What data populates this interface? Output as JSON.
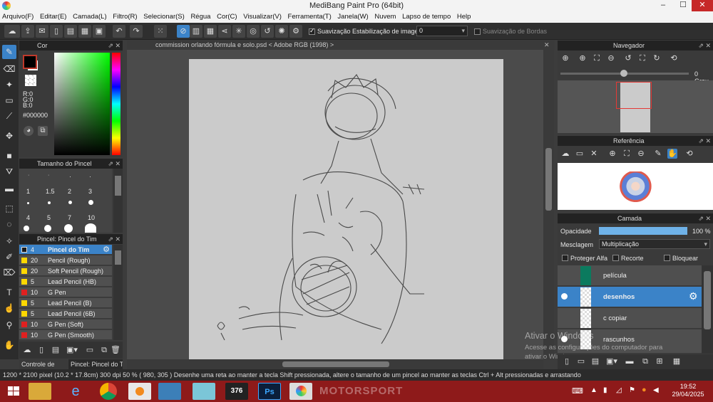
{
  "window": {
    "title": "MediBang Paint Pro (64bit)",
    "minimize": "–",
    "maximize": "☐",
    "close": "✕"
  },
  "menu": [
    "Arquivo(F)",
    "Editar(E)",
    "Camada(L)",
    "Filtro(R)",
    "Selecionar(S)",
    "Régua",
    "Cor(C)",
    "Visualizar(V)",
    "Ferramenta(T)",
    "Janela(W)",
    "Nuvem",
    "Lapso de tempo",
    "Help"
  ],
  "toolbar": {
    "smoothing_label": "Suavização",
    "stabilization_label": "Estabilização de imagens",
    "stabilization_value": "0",
    "edge_smoothing_label": "Suavização de Bordas"
  },
  "color_panel": {
    "title": "Cor",
    "r": "R:0",
    "g": "G:0",
    "b": "B:0",
    "hex": "#000000",
    "fg": "#000000",
    "bg": "#ffffff"
  },
  "brush_size_panel": {
    "title": "Tamanho do Pincel",
    "row1": [
      "1",
      "1.5",
      "2",
      "3"
    ],
    "row2": [
      "4",
      "5",
      "7",
      "10"
    ]
  },
  "brush_panel": {
    "title": "Pincel: Pincel do Tim",
    "items": [
      {
        "size": "4",
        "name": "Pincel do Tim",
        "color": "#1a1a1a"
      },
      {
        "size": "20",
        "name": "Pencil (Rough)",
        "color": "#ffd800"
      },
      {
        "size": "20",
        "name": "Soft Pencil (Rough)",
        "color": "#ffd800"
      },
      {
        "size": "5",
        "name": "Lead Pencil (HB)",
        "color": "#ffd800"
      },
      {
        "size": "10",
        "name": "G Pen",
        "color": "#e02020"
      },
      {
        "size": "5",
        "name": "Lead Pencil (B)",
        "color": "#ffd800"
      },
      {
        "size": "5",
        "name": "Lead Pencil (6B)",
        "color": "#ffd800"
      },
      {
        "size": "10",
        "name": "G Pen (Soft)",
        "color": "#e02020"
      },
      {
        "size": "10",
        "name": "G Pen (Smooth)",
        "color": "#e02020"
      }
    ]
  },
  "bottom_tabs": {
    "left": "Controle de Pincel",
    "right": "Pincel: Pincel do Tim"
  },
  "document": {
    "tab": "commission orlando fórmula e solo.psd < Adobe RGB (1998) >"
  },
  "navigator": {
    "title": "Navegador",
    "angle": "0 Grau"
  },
  "reference": {
    "title": "Referência"
  },
  "layer_panel": {
    "title": "Camada",
    "opacity_label": "Opacidade",
    "opacity_value": "100 %",
    "opacity_fraction": 1.0,
    "blend_label": "Mesclagem",
    "blend_value": "Multiplicação",
    "protect_alpha": "Proteger Alfa",
    "clipping": "Recorte",
    "lock": "Bloquear",
    "layers": [
      {
        "name": "película",
        "color": "#0b7a5e"
      },
      {
        "name": "desenhos"
      },
      {
        "name": "c copiar"
      },
      {
        "name": "rascunhos"
      }
    ]
  },
  "watermark": {
    "line1": "Ativar o Windows",
    "line2": "Acesse as configurações do computador para",
    "line3": "ativar o Windows."
  },
  "status": {
    "size": "1200 * 2100 pixel",
    "cm": "(10.2 * 17.8cm)",
    "dpi": "300 dpi",
    "zoom": "50 %",
    "coords": "( 980, 305 )",
    "hint": "Desenhe uma reta ao manter a tecla Shift pressionada, altere o tamanho de um pincel ao manter as teclas Ctrl + Alt pressionadas e arrastando"
  },
  "taskbar": {
    "time": "19:52",
    "date": "29/04/2025",
    "badge": "376",
    "ps": "Ps",
    "bg_text": "MOTORSPORT"
  }
}
